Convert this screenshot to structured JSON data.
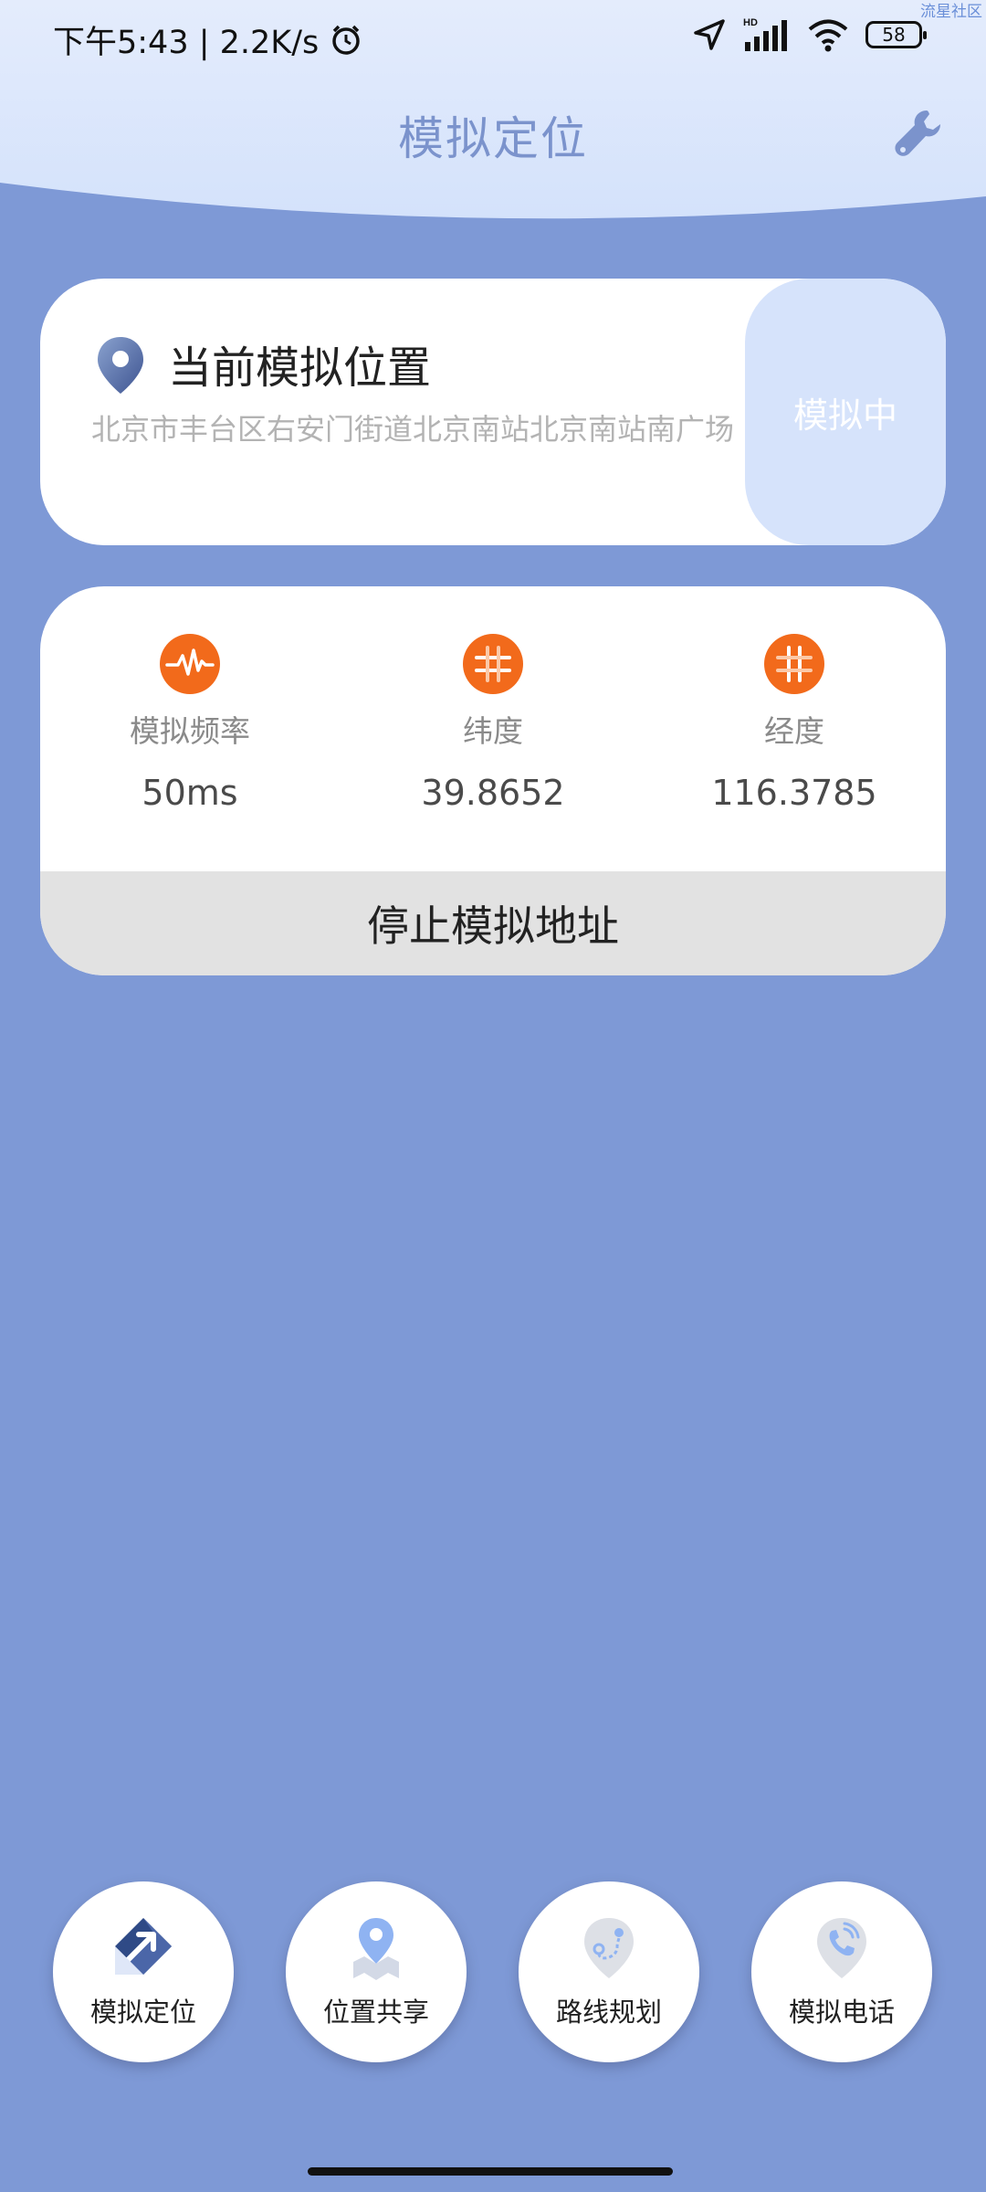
{
  "statusbar": {
    "time_speed": "下午5:43 | 2.2K/s",
    "battery": "58",
    "watermark": "流星社区"
  },
  "header": {
    "title": "模拟定位"
  },
  "location_card": {
    "title": "当前模拟位置",
    "address": "北京市丰台区右安门街道北京南站北京南站南广场",
    "status_button": "模拟中"
  },
  "stats_card": {
    "stats": [
      {
        "label": "模拟频率",
        "value": "50ms",
        "icon": "waveform-icon"
      },
      {
        "label": "纬度",
        "value": "39.8652",
        "icon": "hash-icon"
      },
      {
        "label": "经度",
        "value": "116.3785",
        "icon": "hash-icon"
      }
    ],
    "stop_button": "停止模拟地址"
  },
  "bottom_nav": {
    "items": [
      {
        "label": "模拟定位",
        "icon": "navigation-arrow-icon"
      },
      {
        "label": "位置共享",
        "icon": "location-share-icon"
      },
      {
        "label": "路线规划",
        "icon": "route-plan-icon"
      },
      {
        "label": "模拟电话",
        "icon": "phone-icon"
      }
    ]
  },
  "colors": {
    "background": "#7e99d6",
    "header": "#d7e4fb",
    "accent_orange": "#f26a1b",
    "title": "#7b93cc"
  }
}
